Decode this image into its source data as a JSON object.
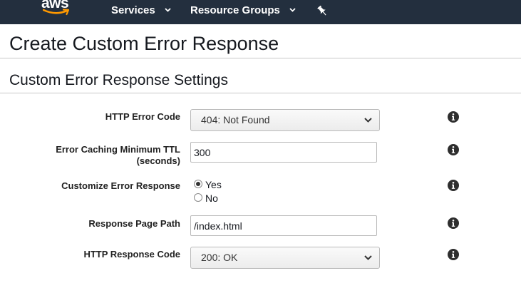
{
  "nav": {
    "logo_text": "aws",
    "services_label": "Services",
    "resource_groups_label": "Resource Groups"
  },
  "page": {
    "title": "Create Custom Error Response",
    "section_title": "Custom Error Response Settings"
  },
  "form": {
    "http_error_code": {
      "label": "HTTP Error Code",
      "value": "404: Not Found"
    },
    "error_caching_ttl": {
      "label_line1": "Error Caching Minimum TTL",
      "label_line2": "(seconds)",
      "value": "300"
    },
    "customize_error_response": {
      "label": "Customize Error Response",
      "options": [
        "Yes",
        "No"
      ],
      "selected": "Yes"
    },
    "response_page_path": {
      "label": "Response Page Path",
      "value": "/index.html"
    },
    "http_response_code": {
      "label": "HTTP Response Code",
      "value": "200: OK"
    }
  },
  "icons": {
    "info": "info-icon",
    "pin": "pin-icon",
    "chevron": "chevron-down-icon"
  },
  "colors": {
    "nav_background": "#232f3e",
    "nav_text": "#ffffff",
    "text_primary": "#16191f",
    "divider": "#c8c8c8"
  }
}
